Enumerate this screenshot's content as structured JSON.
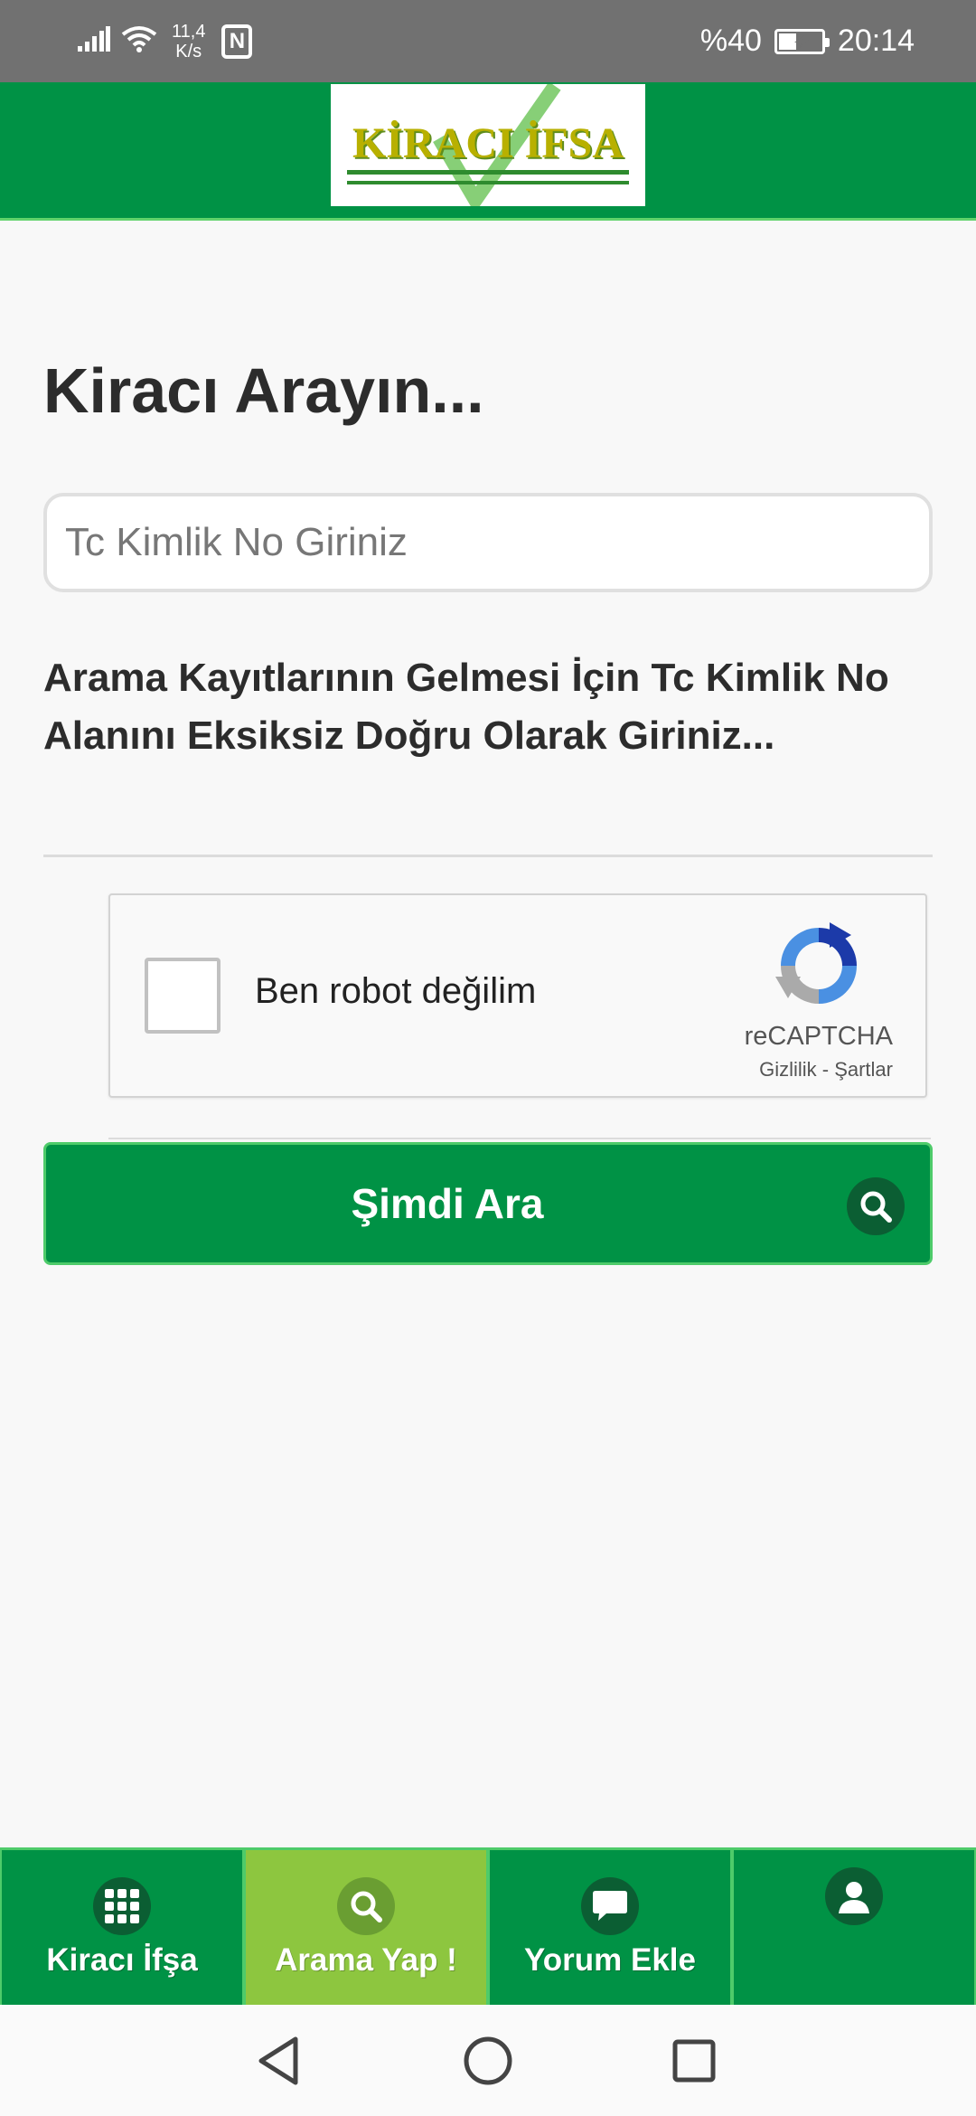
{
  "statusbar": {
    "net_speed_value": "11,4",
    "net_speed_unit": "K/s",
    "battery_percent_label": "%40",
    "battery_level": 0.4,
    "time": "20:14",
    "nfc_glyph": "N"
  },
  "header": {
    "logo_text": "KİRACI İFSA"
  },
  "main": {
    "title": "Kiracı Arayın...",
    "tc_input": {
      "placeholder": "Tc Kimlik No Giriniz",
      "value": ""
    },
    "info_text": "Arama Kayıtlarının Gelmesi İçin Tc Kimlik No Alanını Eksiksiz Doğru Olarak Giriniz...",
    "recaptcha": {
      "label": "Ben robot değilim",
      "brand": "reCAPTCHA",
      "terms": "Gizlilik - Şartlar"
    },
    "search_button_label": "Şimdi Ara"
  },
  "tabbar": {
    "tabs": [
      {
        "label": "Kiracı İfşa",
        "icon": "grid-icon",
        "active": false
      },
      {
        "label": "Arama Yap !",
        "icon": "search-icon",
        "active": true
      },
      {
        "label": "Yorum Ekle",
        "icon": "comment-icon",
        "active": false
      },
      {
        "label": "",
        "icon": "user-icon",
        "active": false
      }
    ]
  },
  "colors": {
    "brand_green": "#009245",
    "active_tab": "#8dc63f",
    "status_bar": "#717171"
  }
}
